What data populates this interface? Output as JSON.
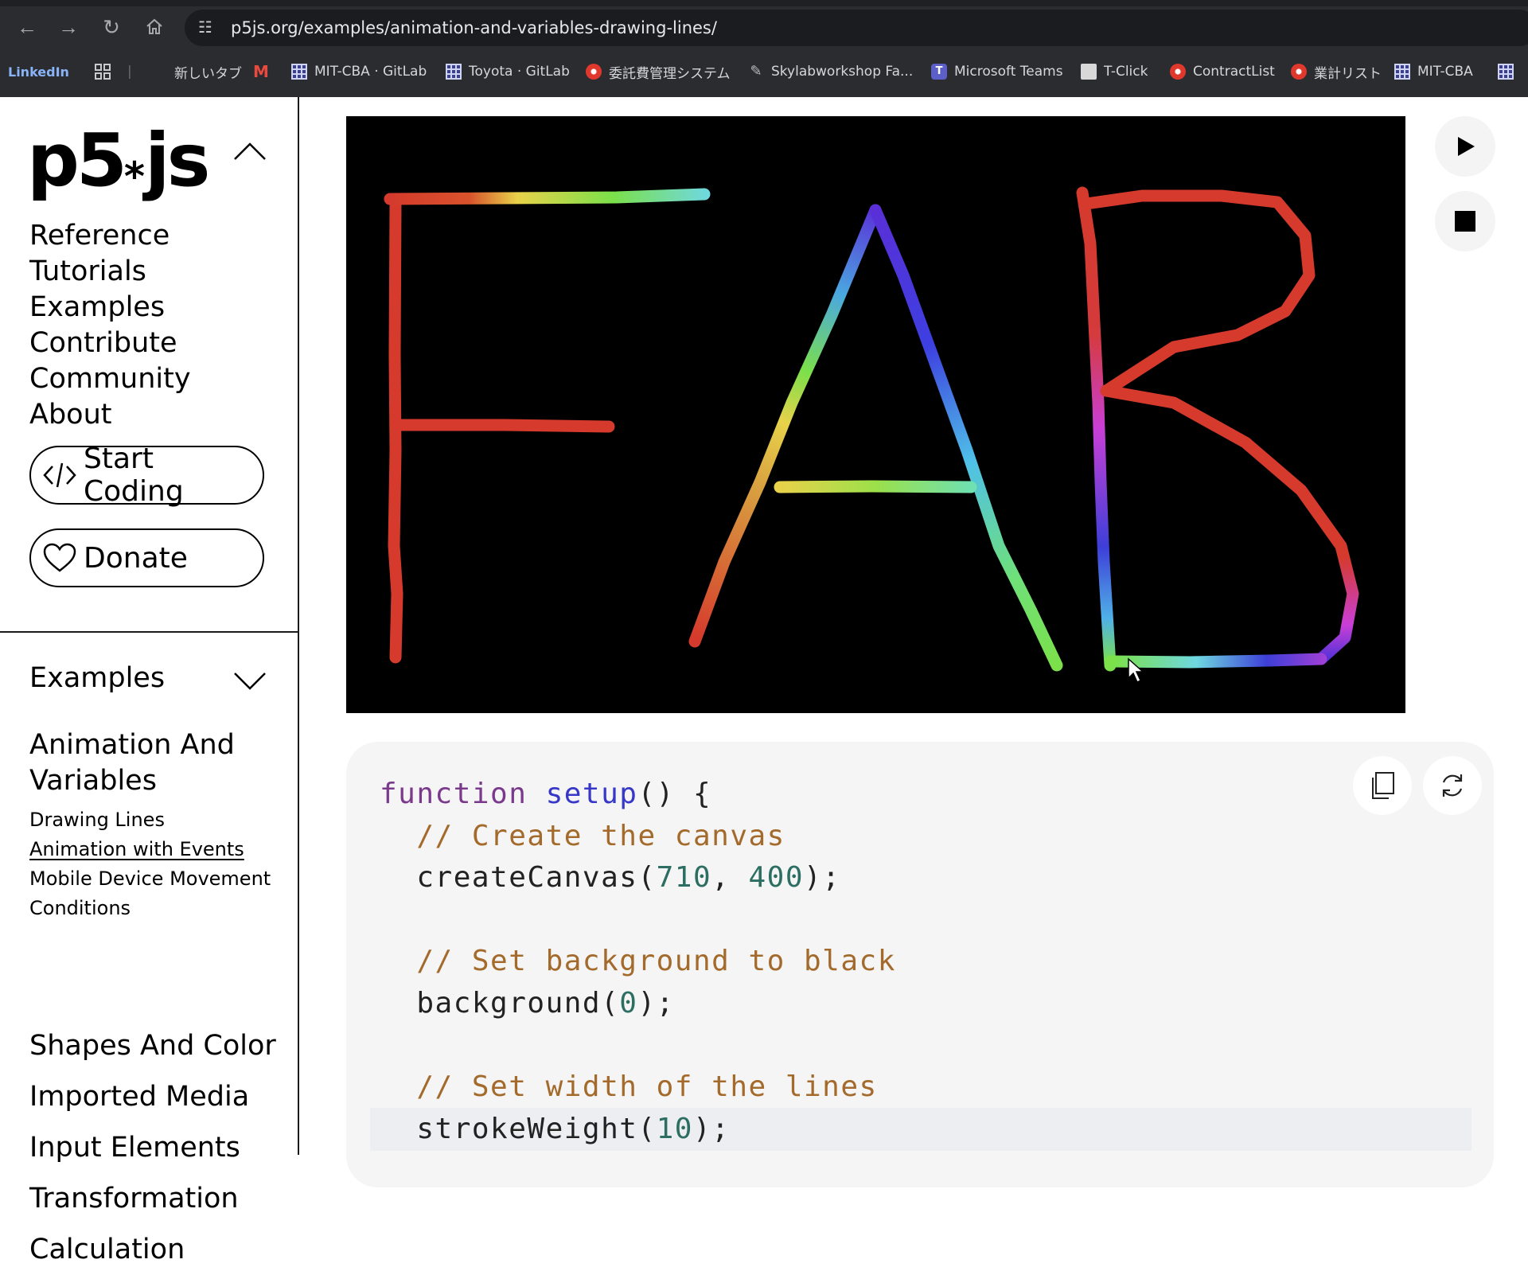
{
  "browser": {
    "url": "p5js.org/examples/animation-and-variables-drawing-lines/",
    "bookmarks": [
      {
        "label": "LinkedIn",
        "icon": "linkedin-icon"
      },
      {
        "label": "新しいタブ",
        "icon": "new-tab-icon"
      },
      {
        "label": "",
        "icon": "gmail-icon"
      },
      {
        "label": "MIT-CBA · GitLab",
        "icon": "gitlab-grid-icon"
      },
      {
        "label": "Toyota · GitLab",
        "icon": "gitlab-grid-icon"
      },
      {
        "label": "委託費管理システム",
        "icon": "red-circle-icon"
      },
      {
        "label": "Skylabworkshop Fa...",
        "icon": "pen-icon"
      },
      {
        "label": "Microsoft Teams",
        "icon": "teams-icon"
      },
      {
        "label": "T-Click",
        "icon": "tclick-icon"
      },
      {
        "label": "ContractList",
        "icon": "red-circle-icon"
      },
      {
        "label": "業計リスト",
        "icon": "red-circle-icon"
      },
      {
        "label": "MIT-CBA",
        "icon": "gitlab-grid-icon"
      }
    ]
  },
  "sidebar": {
    "logo": "p5",
    "logo_ast": "*",
    "logo_tail": "js",
    "nav": [
      "Reference",
      "Tutorials",
      "Examples",
      "Contribute",
      "Community",
      "About"
    ],
    "start_coding": "Start Coding",
    "donate": "Donate",
    "examples_heading": "Examples",
    "category_title": "Animation And Variables",
    "sub_items": [
      "Drawing Lines",
      "Animation with Events",
      "Mobile Device Movement",
      "Conditions"
    ],
    "current_sub": "Animation with Events",
    "categories": [
      "Shapes And Color",
      "Imported Media",
      "Input Elements",
      "Transformation",
      "Calculation"
    ]
  },
  "sketch": {
    "drawn_text": "FAB",
    "background": "#000000",
    "stroke_colors": [
      "#d53a2c",
      "#e8d24a",
      "#7be04a",
      "#6fd8e0",
      "#3d2fd8",
      "#c93fd6"
    ]
  },
  "code": {
    "lines": [
      [
        {
          "t": "function",
          "c": "kw"
        },
        {
          "t": " "
        },
        {
          "t": "setup",
          "c": "fn"
        },
        {
          "t": "() {"
        }
      ],
      [
        {
          "t": "  "
        },
        {
          "t": "// Create the canvas",
          "c": "cm"
        }
      ],
      [
        {
          "t": "  createCanvas("
        },
        {
          "t": "710",
          "c": "nm"
        },
        {
          "t": ", "
        },
        {
          "t": "400",
          "c": "nm"
        },
        {
          "t": ");"
        }
      ],
      [
        {
          "t": ""
        }
      ],
      [
        {
          "t": "  "
        },
        {
          "t": "// Set background to black",
          "c": "cm"
        }
      ],
      [
        {
          "t": "  background("
        },
        {
          "t": "0",
          "c": "nm"
        },
        {
          "t": ");"
        }
      ],
      [
        {
          "t": ""
        }
      ],
      [
        {
          "t": "  "
        },
        {
          "t": "// Set width of the lines",
          "c": "cm"
        }
      ],
      [
        {
          "t": "  strokeWeight("
        },
        {
          "t": "10",
          "c": "nm"
        },
        {
          "t": ");"
        }
      ]
    ]
  }
}
